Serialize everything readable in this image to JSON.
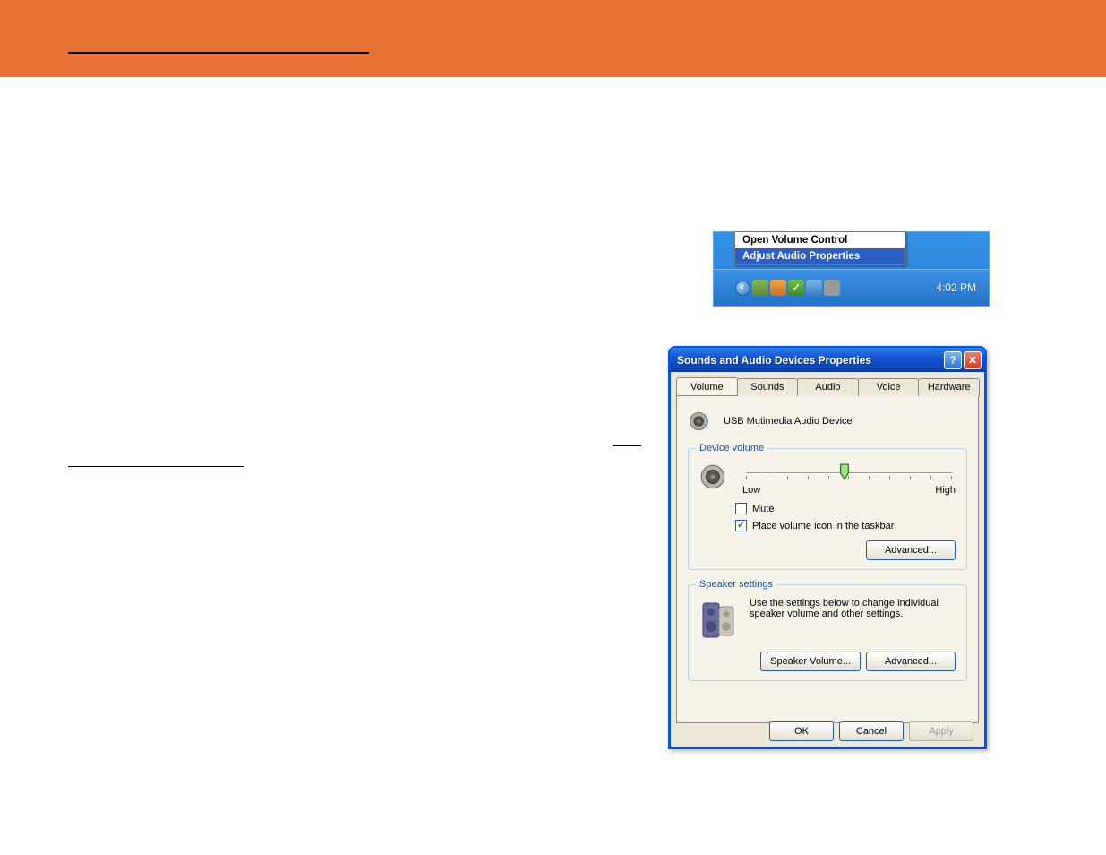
{
  "contextMenu": {
    "items": [
      "Open Volume Control",
      "Adjust Audio Properties"
    ],
    "selectedIndex": 1
  },
  "taskbar": {
    "time": "4:02 PM"
  },
  "dialog": {
    "title": "Sounds and Audio Devices Properties",
    "tabs": [
      "Volume",
      "Sounds",
      "Audio",
      "Voice",
      "Hardware"
    ],
    "activeTab": 0,
    "deviceName": "USB Mutimedia Audio Device",
    "deviceVolume": {
      "legend": "Device volume",
      "lowLabel": "Low",
      "highLabel": "High",
      "muteLabel": "Mute",
      "muteChecked": false,
      "trayIconLabel": "Place volume icon in the taskbar",
      "trayIconChecked": true,
      "advancedBtn": "Advanced..."
    },
    "speakerSettings": {
      "legend": "Speaker settings",
      "description": "Use the settings below to change individual speaker volume and other settings.",
      "speakerVolumeBtn": "Speaker Volume...",
      "advancedBtn": "Advanced..."
    },
    "buttons": {
      "ok": "OK",
      "cancel": "Cancel",
      "apply": "Apply"
    }
  }
}
